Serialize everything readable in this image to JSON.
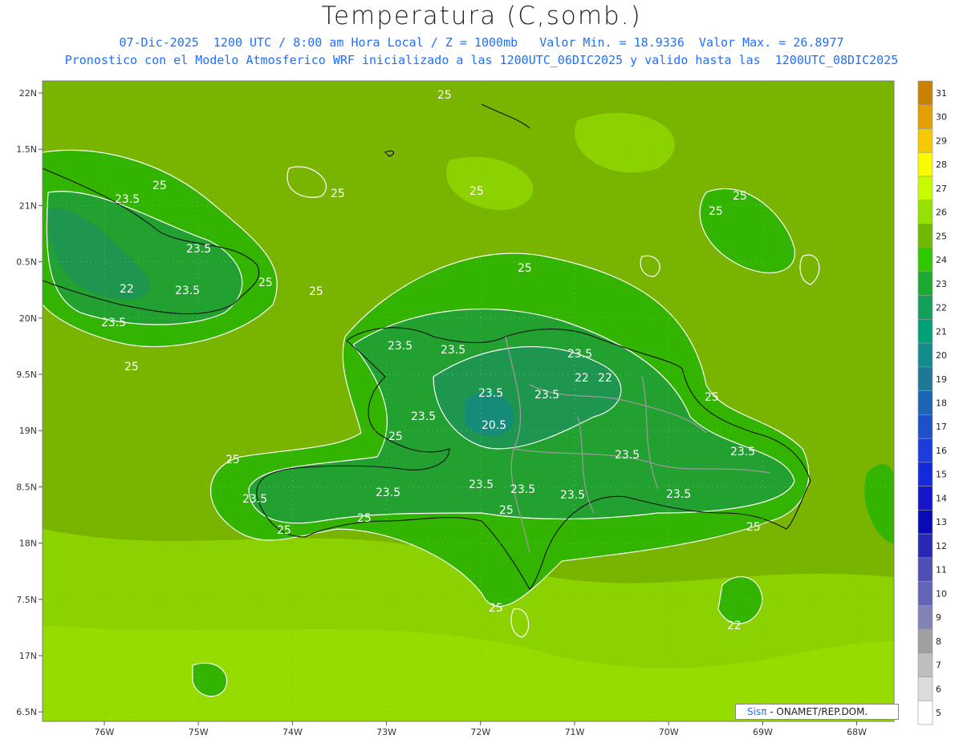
{
  "header": {
    "title": "Temperatura (C,somb.)",
    "line1": "07-Dic-2025  1200 UTC / 8:00 am Hora Local / Z = 1000mb   Valor Min. = 18.9336  Valor Max. = 26.8977",
    "line2": "Pronostico con el Modelo Atmosferico WRF inicializado a las 1200UTC_06DIC2025 y valido hasta las  1200UTC_08DIC2025"
  },
  "axes": {
    "lat_labels": [
      "22N",
      "1.5N",
      "21N",
      "0.5N",
      "20N",
      "9.5N",
      "19N",
      "8.5N",
      "18N",
      "7.5N",
      "17N",
      "6.5N"
    ],
    "lon_labels": [
      "76W",
      "75W",
      "74W",
      "73W",
      "72W",
      "71W",
      "70W",
      "69W",
      "68W"
    ]
  },
  "colorbar": {
    "levels": [
      "31",
      "30",
      "29",
      "28",
      "27",
      "26",
      "25",
      "24",
      "23",
      "22",
      "21",
      "20",
      "19",
      "18",
      "17",
      "16",
      "15",
      "14",
      "13",
      "12",
      "11",
      "10",
      "9",
      "8",
      "7",
      "6",
      "5"
    ],
    "colors": [
      "#c88200",
      "#e1a000",
      "#f5c800",
      "#fafa00",
      "#c8fa00",
      "#96e100",
      "#6eb900",
      "#32c800",
      "#1eaa32",
      "#14a05a",
      "#00a078",
      "#148c8c",
      "#1e7896",
      "#1e64b4",
      "#1e50c8",
      "#1e3cdc",
      "#1428dc",
      "#1414c8",
      "#0a0ab4",
      "#2828b4",
      "#5050b4",
      "#6464b4",
      "#8282b4",
      "#a0a0a0",
      "#bebebe",
      "#dcdcdc",
      "#ffffff"
    ]
  },
  "contour_labels": [
    "25",
    "25",
    "25",
    "25",
    "25",
    "23.5",
    "23.5",
    "23.5",
    "22",
    "25",
    "25",
    "25",
    "25",
    "23.5",
    "23.5",
    "23.5",
    "22",
    "22",
    "20.5",
    "23.5",
    "23.5",
    "23.5",
    "23.5",
    "25",
    "25",
    "25",
    "23.5",
    "23.5",
    "23.5",
    "23.5",
    "23.5",
    "25",
    "25",
    "25",
    "25",
    "25",
    "23.5",
    "23.5",
    "25",
    "22",
    "23.5"
  ],
  "credit": {
    "brand": "Sisπ",
    "text": " - ONAMET/REP.DOM."
  }
}
